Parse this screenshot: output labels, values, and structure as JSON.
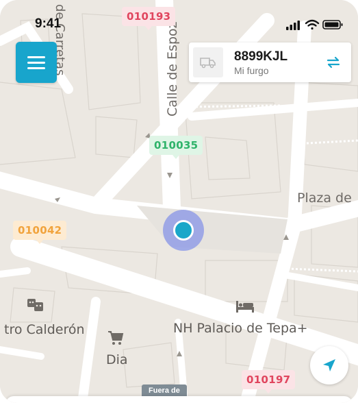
{
  "status_bar": {
    "time": "9:41"
  },
  "map": {
    "streets": {
      "calle": "Calle de Espoz",
      "carretas": "de Carretas",
      "plaza": "Plaza de"
    },
    "pois": {
      "teatro": "tro Calderón",
      "hotel": "NH Palacio de Tepa+",
      "dia": "Dia"
    },
    "tags": [
      {
        "code": "010193",
        "color": "red"
      },
      {
        "code": "010035",
        "color": "green"
      },
      {
        "code": "010042",
        "color": "orange"
      },
      {
        "code": "010197",
        "color": "red"
      }
    ],
    "zone_badge": "Fuera de"
  },
  "vehicle": {
    "plate": "8899KJL",
    "subtitle": "Mi furgo"
  },
  "colors": {
    "accent": "#18a5cc",
    "tag_red": "#e0455e",
    "tag_green": "#2fb36a",
    "tag_orange": "#f1a33c",
    "location_halo": "#6478eb"
  }
}
